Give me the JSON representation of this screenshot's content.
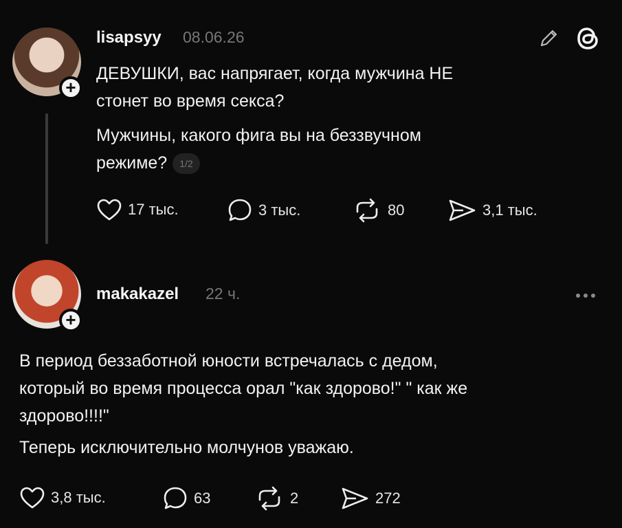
{
  "post": {
    "username": "lisapsyy",
    "date": "08.06.26",
    "line1": "ДЕВУШКИ, вас напрягает, когда мужчина НЕ",
    "line2": "стонет во время секса?",
    "line3": "Мужчины, какого фига вы на беззвучном",
    "line4": "режиме?",
    "pager": "1/2",
    "likes": "17 тыс.",
    "comments": "3 тыс.",
    "reposts": "80",
    "shares": "3,1 тыс."
  },
  "reply": {
    "username": "makakazel",
    "time": "22 ч.",
    "line1": "В период беззаботной юности встречалась с дедом,",
    "line2": "который во время процесса орал \"как здорово!\" \" как же",
    "line3": "здорово!!!!\"",
    "line4": "Теперь исключительно молчунов уважаю.",
    "likes": "3,8 тыс.",
    "comments": "63",
    "reposts": "2",
    "shares": "272"
  },
  "icons": [
    "pencil-icon",
    "threads-logo-icon",
    "heart-icon",
    "comment-icon",
    "repost-icon",
    "share-icon",
    "more-icon",
    "plus-icon"
  ]
}
